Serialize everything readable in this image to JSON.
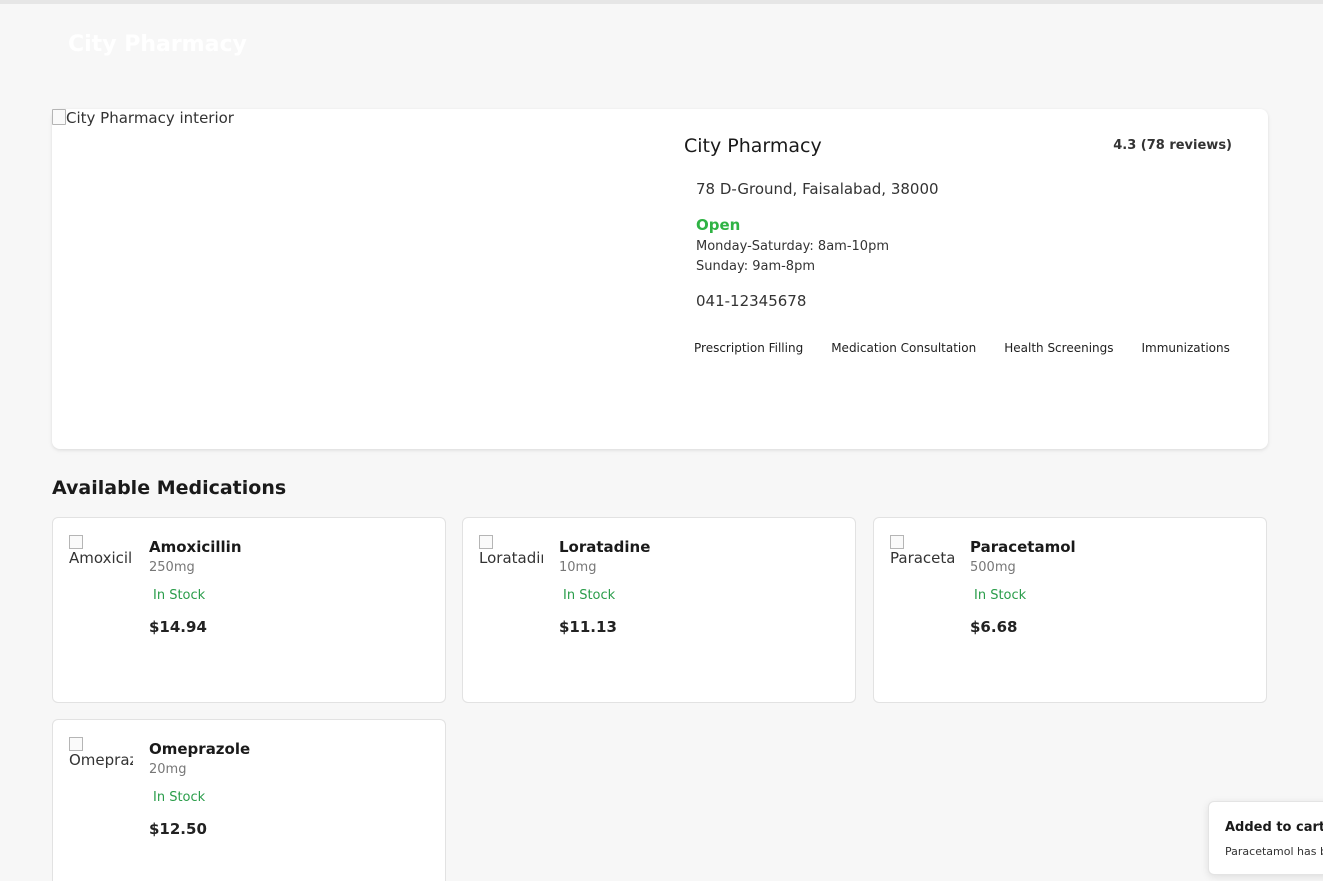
{
  "header": {
    "title": "City Pharmacy"
  },
  "pharmacy": {
    "image_alt": "City Pharmacy interior",
    "name": "City Pharmacy",
    "rating": "4.3 (78 reviews)",
    "address": "78 D-Ground, Faisalabad, 38000",
    "status": "Open",
    "hours": [
      "Monday-Saturday: 8am-10pm",
      "Sunday: 9am-8pm"
    ],
    "phone": "041-12345678",
    "services": [
      "Prescription Filling",
      "Medication Consultation",
      "Health Screenings",
      "Immunizations"
    ],
    "status_color": "#2fb344"
  },
  "medications_section": {
    "title": "Available Medications"
  },
  "medications": [
    {
      "img_alt": "Amoxicill",
      "name": "Amoxicillin",
      "dose": "250mg",
      "stock": "In Stock",
      "price": "$14.94"
    },
    {
      "img_alt": "Loratadir",
      "name": "Loratadine",
      "dose": "10mg",
      "stock": "In Stock",
      "price": "$11.13"
    },
    {
      "img_alt": "Paracetar",
      "name": "Paracetamol",
      "dose": "500mg",
      "stock": "In Stock",
      "price": "$6.68"
    },
    {
      "img_alt": "Omepraz",
      "name": "Omeprazole",
      "dose": "20mg",
      "stock": "In Stock",
      "price": "$12.50"
    }
  ],
  "toast": {
    "title": "Added to cart",
    "body": "Paracetamol has be"
  }
}
